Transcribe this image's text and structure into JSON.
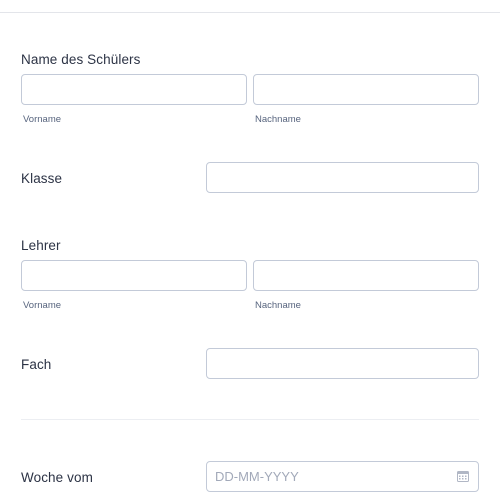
{
  "student": {
    "label": "Name des Schülers",
    "first_label": "Vorname",
    "last_label": "Nachname",
    "first_value": "",
    "last_value": ""
  },
  "class": {
    "label": "Klasse",
    "value": ""
  },
  "teacher": {
    "label": "Lehrer",
    "first_label": "Vorname",
    "last_label": "Nachname",
    "first_value": "",
    "last_value": ""
  },
  "subject": {
    "label": "Fach",
    "value": ""
  },
  "week": {
    "label": "Woche vom",
    "placeholder": "DD-MM-YYYY",
    "icon": "calendar-icon"
  }
}
